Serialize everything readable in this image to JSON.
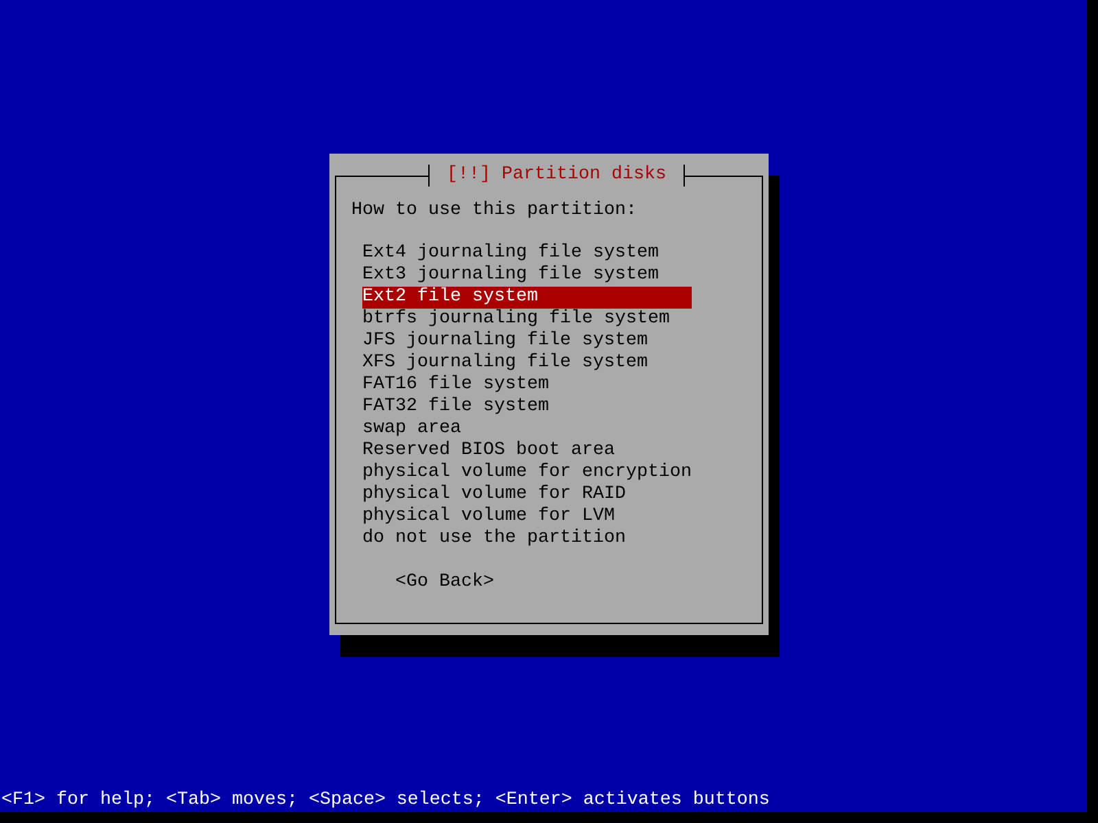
{
  "dialog": {
    "title": "[!!] Partition disks",
    "prompt": "How to use this partition:",
    "options": [
      {
        "label": "Ext4 journaling file system",
        "selected": false
      },
      {
        "label": "Ext3 journaling file system",
        "selected": false
      },
      {
        "label": "Ext2 file system",
        "selected": true
      },
      {
        "label": "btrfs journaling file system",
        "selected": false
      },
      {
        "label": "JFS journaling file system",
        "selected": false
      },
      {
        "label": "XFS journaling file system",
        "selected": false
      },
      {
        "label": "FAT16 file system",
        "selected": false
      },
      {
        "label": "FAT32 file system",
        "selected": false
      },
      {
        "label": "swap area",
        "selected": false
      },
      {
        "label": "Reserved BIOS boot area",
        "selected": false
      },
      {
        "label": "physical volume for encryption",
        "selected": false
      },
      {
        "label": "physical volume for RAID",
        "selected": false
      },
      {
        "label": "physical volume for LVM",
        "selected": false
      },
      {
        "label": "do not use the partition",
        "selected": false
      }
    ],
    "buttons": [
      "<Go Back>"
    ]
  },
  "status_bar": "<F1> for help; <Tab> moves; <Space> selects; <Enter> activates buttons"
}
